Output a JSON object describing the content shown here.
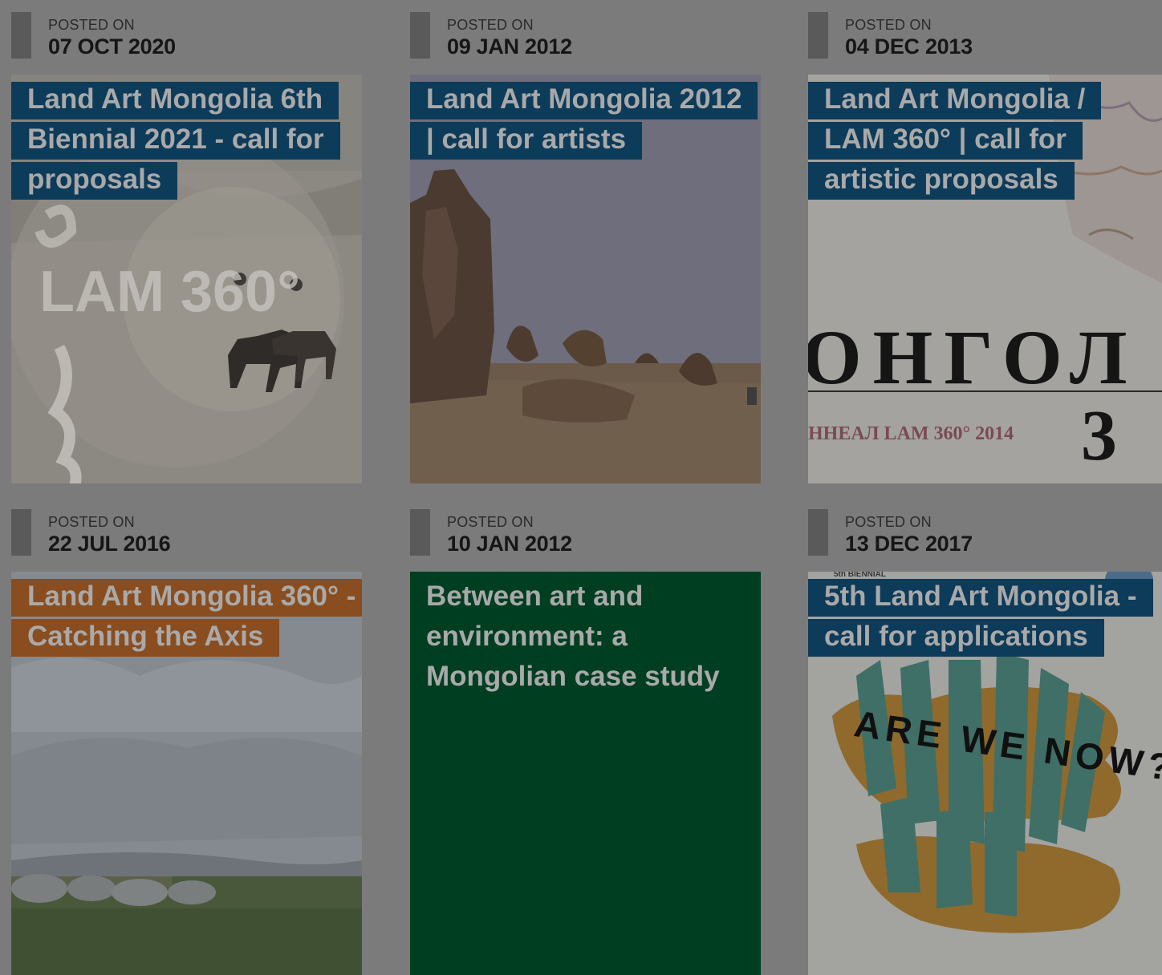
{
  "label_posted": "POSTED ON",
  "posts": [
    {
      "date": "07 OCT 2020",
      "title": "Land Art Mongolia 6th Biennial 2021 - call for proposals",
      "image_text_1": "LAM 360°",
      "image_text_2": ""
    },
    {
      "date": "09 JAN 2012",
      "title": "Land Art Mongolia 2012 | call for artists",
      "image_text_1": "",
      "image_text_2": ""
    },
    {
      "date": "04 DEC 2013",
      "title": "Land Art Mongolia / LAM 360° | call for artistic proposals",
      "image_text_1": "ОНГОЛ",
      "image_text_2": "ННЕАЛ LAM 360° 2014"
    },
    {
      "date": "22 JUL 2016",
      "title": "Land Art Mongolia 360° - Catching the Axis",
      "image_text_1": "",
      "image_text_2": ""
    },
    {
      "date": "10 JAN 2012",
      "title": "Between art and environment: a Mongolian case study",
      "image_text_1": "",
      "image_text_2": ""
    },
    {
      "date": "13 DEC 2017",
      "title": "5th Land Art Mongolia - call for applications",
      "image_text_1": "ARE WE NOW?",
      "image_text_2": "5th BIENNIAL"
    }
  ]
}
